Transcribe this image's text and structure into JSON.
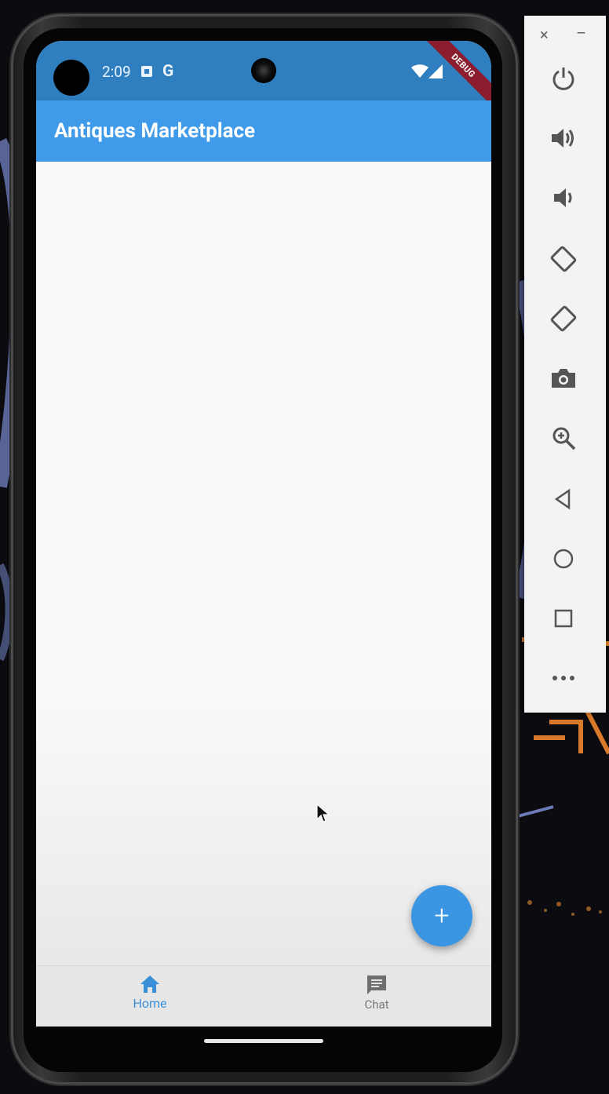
{
  "status_bar": {
    "time": "2:09",
    "debug_banner": "DEBUG"
  },
  "app_bar": {
    "title": "Antiques Marketplace"
  },
  "fab": {
    "icon": "+"
  },
  "bottom_nav": {
    "items": [
      {
        "label": "Home",
        "icon": "home-icon",
        "selected": true
      },
      {
        "label": "Chat",
        "icon": "chat-icon",
        "selected": false
      }
    ]
  },
  "emulator_toolbar": {
    "close_icon": "×",
    "minimize_icon": "–",
    "buttons": [
      "power-icon",
      "volume-up-icon",
      "volume-down-icon",
      "rotate-left-icon",
      "rotate-right-icon",
      "camera-icon",
      "zoom-icon",
      "back-icon",
      "home-circle-icon",
      "overview-icon",
      "more-icon"
    ]
  },
  "colors": {
    "status_bar": "#2f7ebf",
    "app_bar": "#3f9be9",
    "fab": "#3a96e3",
    "nav_selected": "#3a8fd9",
    "nav_unselected": "#7a7a7a",
    "debug_ribbon": "#8c1d2f"
  }
}
